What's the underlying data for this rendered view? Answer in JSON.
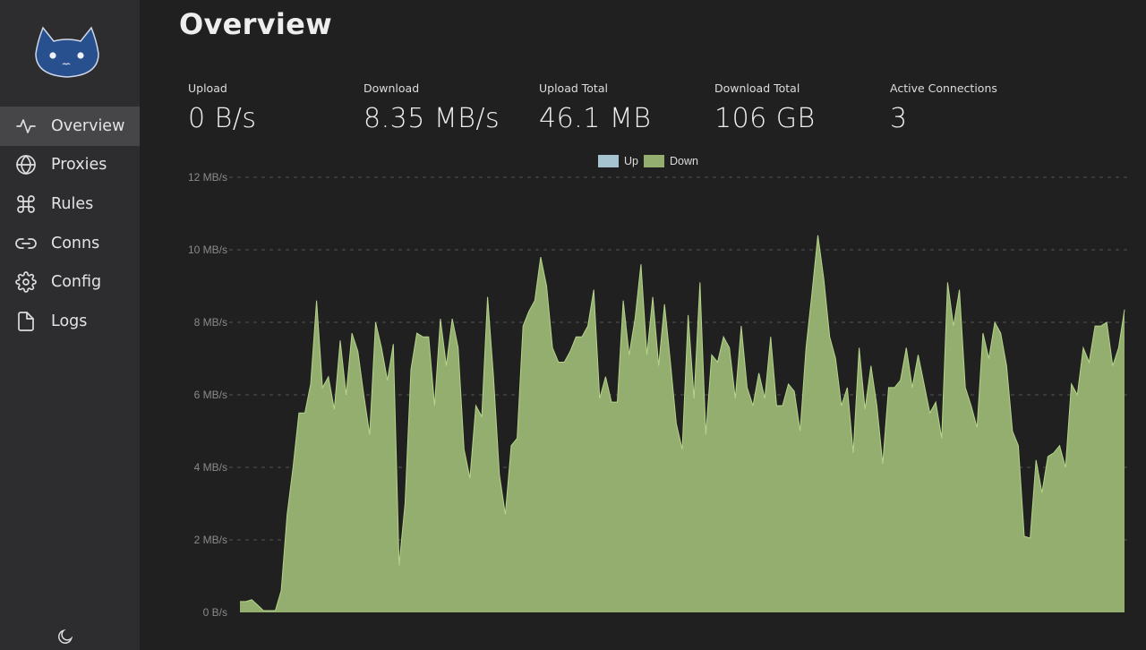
{
  "sidebar": {
    "logo": "cat-logo",
    "items": [
      {
        "label": "Overview",
        "icon": "activity-icon",
        "active": true
      },
      {
        "label": "Proxies",
        "icon": "globe-icon",
        "active": false
      },
      {
        "label": "Rules",
        "icon": "command-icon",
        "active": false
      },
      {
        "label": "Conns",
        "icon": "link-icon",
        "active": false
      },
      {
        "label": "Config",
        "icon": "settings-icon",
        "active": false
      },
      {
        "label": "Logs",
        "icon": "file-icon",
        "active": false
      }
    ],
    "theme_toggle_icon": "moon-icon"
  },
  "main": {
    "title": "Overview",
    "stats": [
      {
        "label": "Upload",
        "value": "0 B/s"
      },
      {
        "label": "Download",
        "value": "8.35 MB/s"
      },
      {
        "label": "Upload Total",
        "value": "46.1 MB"
      },
      {
        "label": "Download Total",
        "value": "106 GB"
      },
      {
        "label": "Active Connections",
        "value": "3"
      }
    ]
  },
  "colors": {
    "up": "#a5c3d0",
    "down": "#93ae6f",
    "down_line": "#b5d48a",
    "accent_logo": "#28508e"
  },
  "chart_data": {
    "type": "area",
    "title": "",
    "xlabel": "",
    "ylabel": "",
    "legend": [
      "Up",
      "Down"
    ],
    "legend_position": "top-center",
    "ylim": [
      0,
      12
    ],
    "yunit": "MB/s",
    "yticks": [
      "0 B/s",
      "2 MB/s",
      "4 MB/s",
      "6 MB/s",
      "8 MB/s",
      "10 MB/s",
      "12 MB/s"
    ],
    "grid": true,
    "series": [
      {
        "name": "Up",
        "values": []
      },
      {
        "name": "Down",
        "values": [
          0.3,
          0.3,
          0.35,
          0.2,
          0.05,
          0.05,
          0.05,
          0.6,
          2.7,
          4.0,
          5.5,
          5.5,
          6.3,
          8.6,
          6.2,
          6.5,
          5.6,
          7.5,
          6.0,
          7.7,
          7.2,
          6.0,
          4.9,
          8.0,
          7.3,
          6.4,
          7.4,
          1.3,
          3.0,
          6.7,
          7.7,
          7.6,
          7.6,
          5.7,
          8.1,
          6.8,
          8.1,
          7.3,
          4.5,
          3.7,
          5.7,
          5.4,
          8.7,
          6.5,
          3.8,
          2.7,
          4.6,
          4.8,
          7.9,
          8.3,
          8.6,
          9.8,
          9.0,
          7.3,
          6.9,
          6.9,
          7.2,
          7.6,
          7.6,
          7.9,
          8.9,
          5.9,
          6.5,
          5.8,
          5.8,
          8.6,
          7.1,
          8.1,
          9.6,
          7.1,
          8.7,
          6.8,
          8.5,
          6.9,
          5.2,
          4.5,
          8.2,
          5.9,
          9.1,
          4.9,
          7.1,
          6.9,
          7.6,
          7.3,
          5.9,
          7.9,
          6.2,
          5.7,
          6.6,
          5.9,
          7.6,
          5.7,
          5.7,
          6.3,
          6.1,
          5.0,
          7.3,
          8.8,
          10.4,
          9.2,
          7.6,
          7.0,
          5.7,
          6.2,
          4.4,
          7.3,
          5.6,
          6.8,
          5.7,
          4.1,
          6.2,
          6.2,
          6.4,
          7.3,
          6.2,
          7.1,
          6.3,
          5.5,
          5.8,
          4.8,
          9.1,
          7.9,
          8.9,
          6.2,
          5.7,
          5.1,
          7.7,
          7.0,
          8.0,
          7.7,
          6.8,
          5.0,
          4.6,
          2.1,
          2.05,
          4.2,
          3.3,
          4.3,
          4.4,
          4.6,
          4.0,
          6.3,
          6.0,
          7.3,
          6.9,
          7.9,
          7.9,
          8.0,
          6.8,
          7.3,
          8.35
        ]
      }
    ]
  }
}
